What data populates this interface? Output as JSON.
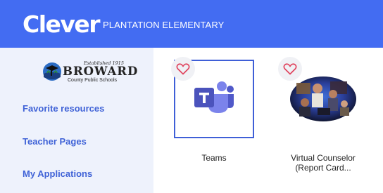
{
  "header": {
    "logo": "Clever",
    "school": "PLANTATION ELEMENTARY"
  },
  "sidebar": {
    "district_logo": {
      "established": "Established 1915",
      "name": "BROWARD",
      "subtitle": "County Public Schools"
    },
    "items": [
      {
        "label": "Favorite resources"
      },
      {
        "label": "Teacher Pages"
      },
      {
        "label": "My Applications"
      }
    ]
  },
  "apps": [
    {
      "label": "Teams",
      "icon": "microsoft-teams-icon",
      "favorited": false
    },
    {
      "label_line1": "Virtual Counselor",
      "label_line2": "(Report Card...",
      "icon": "virtual-counselor-photo",
      "favorited": false
    }
  ],
  "colors": {
    "header_bg": "#436cf2",
    "sidebar_bg": "#eef2fc",
    "nav_link": "#4063d7",
    "heart": "#e0455f",
    "teams_purple": "#5059c9",
    "focus_border": "#3f5fd7"
  }
}
